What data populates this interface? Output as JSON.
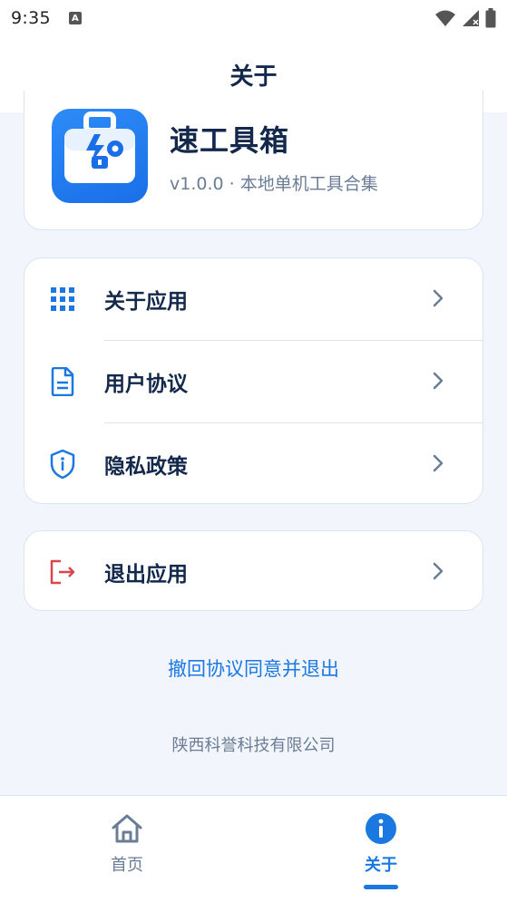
{
  "status_bar": {
    "time": "9:35",
    "notification_icon": "A"
  },
  "app_bar": {
    "title": "关于"
  },
  "app_info": {
    "name": "速工具箱",
    "subtitle": "v1.0.0 · 本地单机工具合集",
    "logo_icon": "toolbox-icon"
  },
  "menu": {
    "items": [
      {
        "label": "关于应用",
        "icon": "grid-icon"
      },
      {
        "label": "用户协议",
        "icon": "document-icon"
      },
      {
        "label": "隐私政策",
        "icon": "shield-info-icon"
      }
    ]
  },
  "exit": {
    "label": "退出应用",
    "icon": "logout-icon"
  },
  "revoke_link": "撤回协议同意并退出",
  "company": "陕西科誉科技有限公司",
  "bottom_nav": {
    "items": [
      {
        "label": "首页",
        "icon": "home-icon",
        "active": false
      },
      {
        "label": "关于",
        "icon": "info-icon",
        "active": true
      }
    ]
  },
  "colors": {
    "accent": "#1a78e0",
    "title": "#13284b",
    "muted": "#6b7c95",
    "danger": "#d9454b",
    "background": "#f2f6fc"
  }
}
